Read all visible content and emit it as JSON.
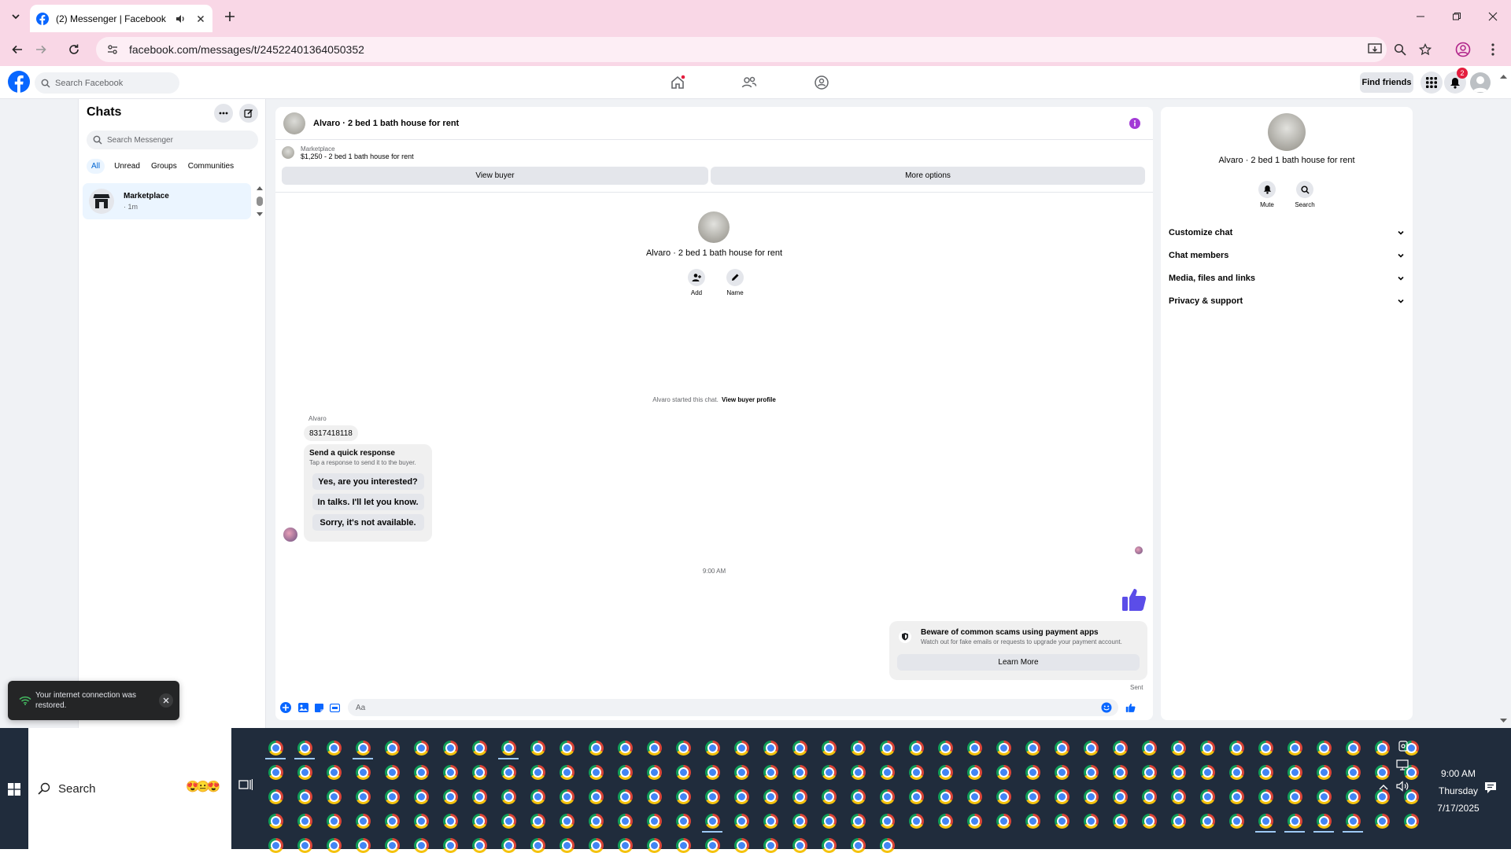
{
  "browser": {
    "tab_title": "(2) Messenger | Facebook",
    "url": "facebook.com/messages/t/24522401364050352"
  },
  "facebook": {
    "search_placeholder": "Search Facebook",
    "find_friends": "Find friends",
    "notification_count": "2"
  },
  "sidebar": {
    "title": "Chats",
    "search_placeholder": "Search Messenger",
    "filters": [
      "All",
      "Unread",
      "Groups",
      "Communities"
    ],
    "chat_item": {
      "name": "Marketplace",
      "time": "· 1m"
    }
  },
  "conversation": {
    "title": "Alvaro · 2 bed 1 bath house for rent",
    "listing_source": "Marketplace",
    "listing_title": "$1,250 - 2 bed 1 bath house for rent",
    "view_buyer": "View buyer",
    "more_options": "More options",
    "intro_name": "Alvaro · 2 bed 1 bath house for rent",
    "add_label": "Add",
    "name_label": "Name",
    "started_text": "Alvaro started this chat.",
    "view_buyer_profile": "View buyer profile",
    "sender_name": "Alvaro",
    "message_text": "8317418118",
    "quick_response_title": "Send a quick response",
    "quick_response_sub": "Tap a response to send it to the buyer.",
    "quick_responses": [
      "Yes, are you interested?",
      "In talks. I'll let you know.",
      "Sorry, it's not available."
    ],
    "timestamp": "9:00 AM",
    "scam_title": "Beware of common scams using payment apps",
    "scam_body": "Watch out for fake emails or requests to upgrade your payment account.",
    "learn_more": "Learn More",
    "sent_status": "Sent",
    "composer_placeholder": "Aa"
  },
  "details": {
    "name": "Alvaro · 2 bed 1 bath house for rent",
    "mute": "Mute",
    "search": "Search",
    "sections": [
      "Customize chat",
      "Chat members",
      "Media, files and links",
      "Privacy & support"
    ]
  },
  "toast": {
    "text": "Your internet connection was restored."
  },
  "taskbar": {
    "search_label": "Search",
    "time": "9:00 AM",
    "day": "Thursday",
    "date": "7/17/2025"
  },
  "colors": {
    "facebook_blue": "#0866ff",
    "messenger_purple": "#5b4de8",
    "tabstrip_pink": "#f9d7e6",
    "taskbar": "#202c3c"
  }
}
